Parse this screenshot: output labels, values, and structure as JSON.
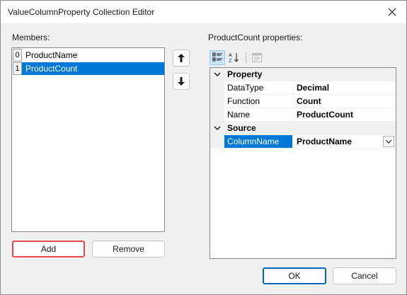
{
  "window": {
    "title": "ValueColumnProperty Collection Editor"
  },
  "members": {
    "label": "Members:",
    "items": [
      {
        "index": "0",
        "name": "ProductName",
        "selected": false
      },
      {
        "index": "1",
        "name": "ProductCount",
        "selected": true
      }
    ]
  },
  "buttons": {
    "add": "Add",
    "remove": "Remove",
    "ok": "OK",
    "cancel": "Cancel"
  },
  "icons": {
    "close": "close-icon",
    "move_up": "arrow-up-icon",
    "move_down": "arrow-down-icon",
    "categorized": "categorized-icon",
    "alphabetical": "sort-alphabetical-icon",
    "property_pages": "property-pages-icon",
    "dropdown": "chevron-down-icon"
  },
  "properties": {
    "label": "ProductCount properties:",
    "categories": [
      {
        "name": "Property",
        "rows": [
          {
            "name": "DataType",
            "value": "Decimal"
          },
          {
            "name": "Function",
            "value": "Count"
          },
          {
            "name": "Name",
            "value": "ProductCount"
          }
        ]
      },
      {
        "name": "Source",
        "rows": [
          {
            "name": "ColumnName",
            "value": "ProductName",
            "selected": true
          }
        ]
      }
    ]
  },
  "colors": {
    "selection": "#0078d7",
    "accent_border": "#e5484d",
    "ok_border": "#0067c0"
  }
}
